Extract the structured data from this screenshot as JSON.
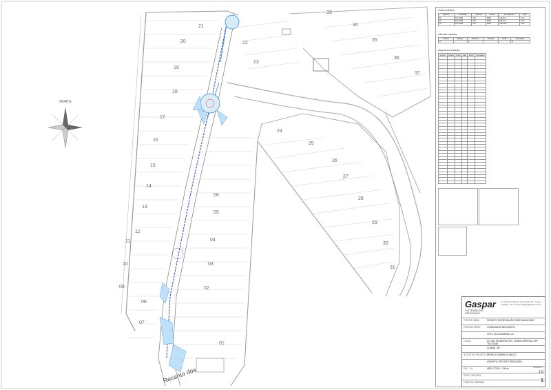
{
  "map": {
    "north_label": "NORTE",
    "bottom_place": "Recanto dos",
    "quadras_left": [
      "21",
      "20",
      "19",
      "18",
      "17",
      "16",
      "15",
      "14",
      "13",
      "12",
      "11",
      "10",
      "09",
      "08",
      "07",
      "06",
      "05",
      "04",
      "03",
      "02",
      "01"
    ],
    "quadras_mid": [
      "22",
      "23",
      "24",
      "25",
      "26",
      "27",
      "28",
      "29",
      "30",
      "31"
    ],
    "quadras_right": [
      "33",
      "34",
      "35",
      "36",
      "37"
    ]
  },
  "panel": {
    "tubes_title": "Tubos Listados",
    "valves_title": "Válvulas Listadas",
    "sprinklers_title": "Aspersores Listados",
    "tubes_header": [
      "Diâmetro",
      "Descrição",
      "Material",
      "Classe",
      "Comprimento",
      "Qtde"
    ],
    "tubes_rows": [
      [
        "50",
        "PVC PN80",
        "PVC",
        "PN80",
        "128.00 m",
        "Tubo"
      ],
      [
        "32",
        "PVC PN80",
        "PVC",
        "PN80",
        "845.00 m",
        "Tubo"
      ],
      [
        "25",
        "PVC PN80",
        "PVC",
        "PN80",
        "1000.00 m",
        "Tubo"
      ]
    ],
    "valves_header": [
      "Símbolo",
      "Modelo",
      "Diâmetro",
      "Pressão",
      "Vazão",
      "Quantidade"
    ],
    "valves_rows": [
      [
        "⊘",
        "",
        "1\"",
        "",
        "",
        "12"
      ]
    ],
    "sprinklers_header": [
      "Símbolo",
      "Modelo",
      "Bocal",
      "Raio",
      "Vazão",
      "Quantidade"
    ]
  },
  "title_block": {
    "brand": "Gaspar",
    "brand_sub": "SISTEMAS DE IRRIGAÇÃO",
    "address": "Av. Coronel Frederico de Andrade, 91 · Centro · Ipatinga · MG · E-mail: gaspar@gaspar.com.br",
    "rows": [
      {
        "label": "TIPO DE OBRA:",
        "value": "PROJETO DE IRRIGAÇÃO PARA PAISAGISMO"
      },
      {
        "label": "PROPRIETÁRIO:",
        "value": "CONDOMINIO BELVEDERE"
      },
      {
        "label": "",
        "value": "CNPJ: 00.016.083/0001-10"
      },
      {
        "label": "LOCAL:",
        "value": "AV. DAS PALMEIRAS 870, JARDIM IMPERIAL CEP. 78.075-850"
      },
      {
        "label": "",
        "value": "CUIABÁ - MT"
      },
      {
        "label": "AUTOR DO PROJETO:",
        "value": "PEDRO LEOMARCIO ABICIO"
      },
      {
        "label": "",
        "value": "ASSUNTO: PROJETO IRRIGAÇÃO"
      },
      {
        "label": "ESC.: 1/1",
        "value": "ÁREA TOTAL: 1.05 m²"
      },
      {
        "label": "DATA: 10/01/2021",
        "value": ""
      },
      {
        "label": "FONE DA FINANÇAL:",
        "value": ""
      }
    ],
    "sheet_label": "FOLHA N.º",
    "sheet": "1/3",
    "sheet_number": "1"
  }
}
